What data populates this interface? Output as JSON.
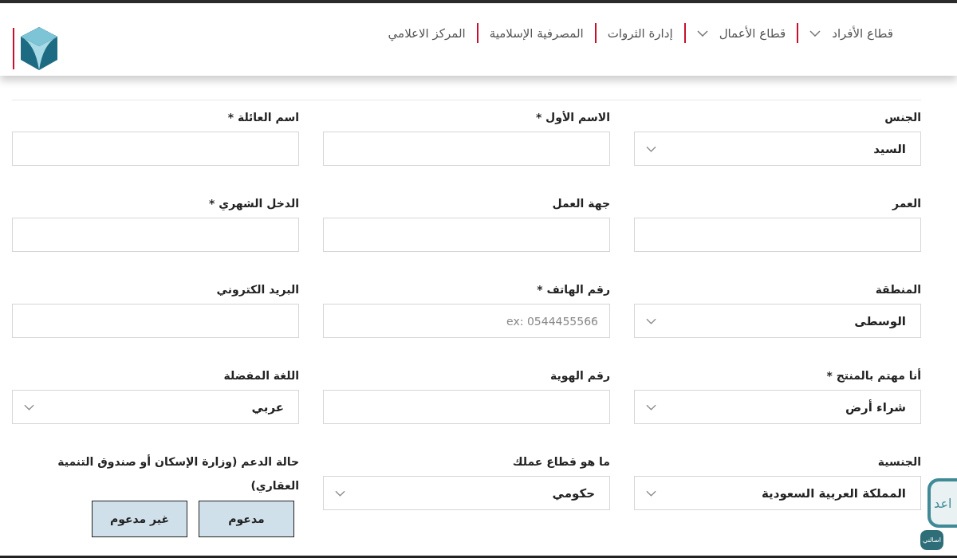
{
  "header": {
    "nav": [
      {
        "label": "قطاع الأفراد",
        "dropdown": true
      },
      {
        "label": "قطاع الأعمال",
        "dropdown": true
      },
      {
        "label": "إدارة الثروات",
        "dropdown": false
      },
      {
        "label": "المصرفية الإسلامية",
        "dropdown": false
      },
      {
        "label": "المركز الاعلامي",
        "dropdown": false
      }
    ]
  },
  "form": {
    "fields": [
      {
        "kind": "select",
        "label": "الجنس",
        "value": "السيد"
      },
      {
        "kind": "input",
        "label": "الاسم الأول *"
      },
      {
        "kind": "input",
        "label": "اسم العائلة *"
      },
      {
        "kind": "input",
        "label": "العمر"
      },
      {
        "kind": "input",
        "label": "جهة العمل"
      },
      {
        "kind": "input",
        "label": "الدخل الشهري *"
      },
      {
        "kind": "select",
        "label": "المنطقة",
        "value": "الوسطى"
      },
      {
        "kind": "input",
        "label": "رقم الهاتف *",
        "placeholder": "ex: 0544455566"
      },
      {
        "kind": "input",
        "label": "البريد الكتروني"
      },
      {
        "kind": "select",
        "label": "أنا مهتم بالمنتج *",
        "value": "شراء أرض"
      },
      {
        "kind": "input",
        "label": "رقم الهوية"
      },
      {
        "kind": "select",
        "label": "اللغة المفضلة",
        "value": "عربي"
      },
      {
        "kind": "select",
        "label": "الجنسية",
        "value": "المملكة العربية السعودية"
      },
      {
        "kind": "select",
        "label": "ما هو قطاع عملك",
        "value": "حكومي"
      },
      {
        "kind": "choice",
        "label": "حالة الدعم (وزارة الإسكان أو صندوق التنمية العقاري)",
        "options": [
          {
            "label": "مدعوم",
            "selected": false
          },
          {
            "label": "غير مدعوم",
            "selected": false
          }
        ]
      }
    ]
  },
  "help_widget": {
    "label": "اعد",
    "badge": "اسالني"
  }
}
